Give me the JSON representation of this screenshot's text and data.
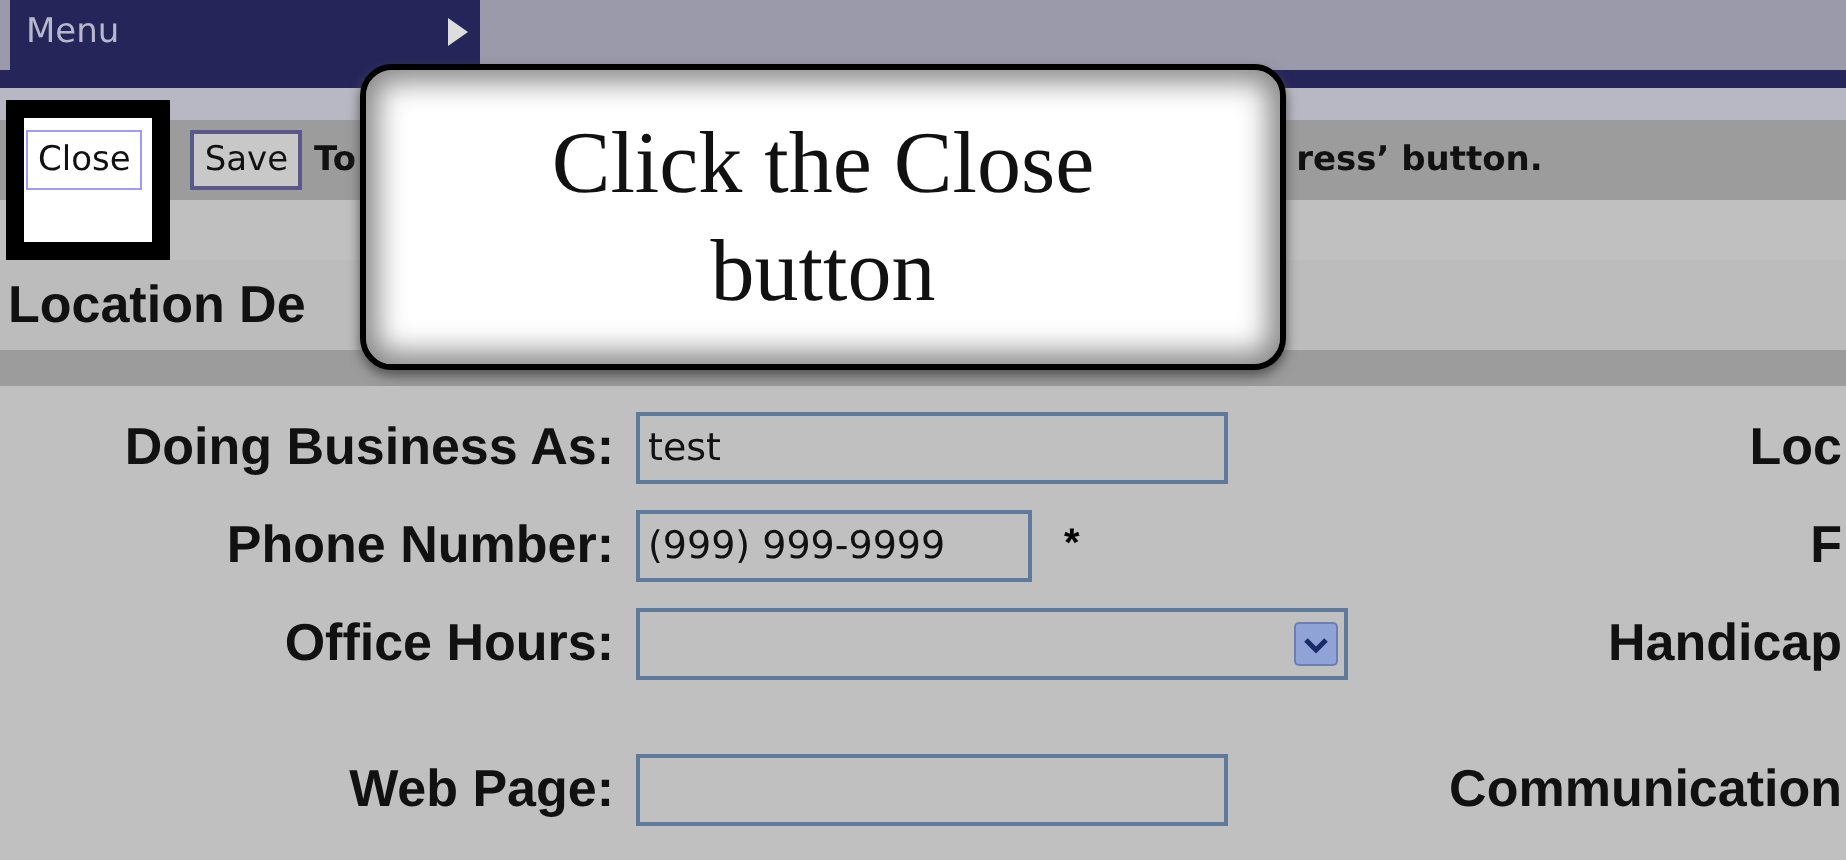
{
  "menu": {
    "label": "Menu"
  },
  "toolbar": {
    "buttons": [
      {
        "label": "Close",
        "highlighted": true
      },
      {
        "label": "Save",
        "highlighted": false
      }
    ],
    "instruction_parts": [
      "To",
      "ress’ button."
    ]
  },
  "section": {
    "title": "Location De"
  },
  "form": {
    "rows": [
      {
        "kind": "text",
        "label": "Doing Business As:",
        "value": "test",
        "right_label": "Loc"
      },
      {
        "kind": "phone",
        "label": "Phone Number:",
        "value": "(999) 999-9999",
        "required_mark": "*",
        "right_label": "F"
      },
      {
        "kind": "select",
        "label": "Office Hours:",
        "right_label": "Handicap"
      },
      {
        "kind": "text",
        "label": "Web Page:",
        "right_label": "Communication"
      }
    ]
  },
  "callout": {
    "text": "Click the Close button"
  }
}
